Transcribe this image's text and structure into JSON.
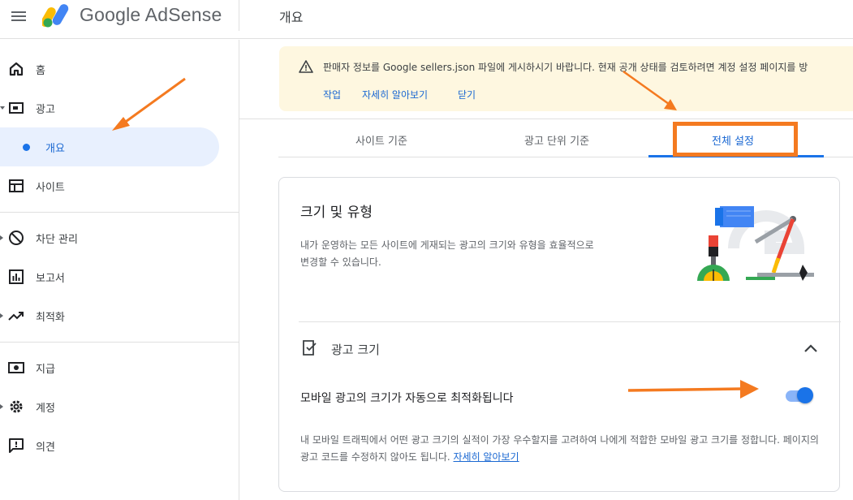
{
  "header": {
    "brand": "Google AdSense",
    "page_title": "개요"
  },
  "sidebar": {
    "items": [
      {
        "label": "홈"
      },
      {
        "label": "광고"
      },
      {
        "label": "개요"
      },
      {
        "label": "사이트"
      },
      {
        "label": "차단 관리"
      },
      {
        "label": "보고서"
      },
      {
        "label": "최적화"
      },
      {
        "label": "지급"
      },
      {
        "label": "계정"
      },
      {
        "label": "의견"
      }
    ]
  },
  "banner": {
    "message": "판매자 정보를 Google sellers.json 파일에 게시하시기 바랍니다. 현재 공개 상태를 검토하려면 계정 설정 페이지를 방",
    "action_label": "작업",
    "learn_more_label": "자세히 알아보기",
    "close_label": "닫기"
  },
  "tabs": [
    {
      "label": "사이트 기준"
    },
    {
      "label": "광고 단위 기준"
    },
    {
      "label": "전체 설정",
      "active": true
    }
  ],
  "card": {
    "title": "크기 및 유형",
    "description": "내가 운영하는 모든 사이트에 게재되는 광고의 크기와 유형을 효율적으로 변경할 수 있습니다.",
    "section_title": "광고 크기",
    "setting_label": "모바일 광고의 크기가 자동으로 최적화됩니다",
    "toggle_on": true,
    "setting_description": "내 모바일 트래픽에서 어떤 광고 크기의 실적이 가장 우수할지를 고려하여 나에게 적합한 모바일 광고 크기를 정합니다. 페이지의 광고 코드를 수정하지 않아도 됩니다. ",
    "setting_link": "자세히 알아보기"
  },
  "icons": {
    "menu": "hamburger-icon",
    "logo": "adsense-logo",
    "home": "home-icon",
    "ads": "ads-icon",
    "sites": "sites-icon",
    "blocking": "block-icon",
    "reports": "reports-icon",
    "optimization": "trending-up-icon",
    "payments": "payments-icon",
    "account": "gear-icon",
    "feedback": "feedback-icon",
    "warning": "warning-icon",
    "ad_size": "ad-size-icon",
    "collapse": "chevron-up-icon"
  },
  "colors": {
    "accent": "#1a73e8",
    "selected_bg": "#e8f0fe",
    "banner_bg": "#fef7e0",
    "annotation": "#f47a20"
  }
}
